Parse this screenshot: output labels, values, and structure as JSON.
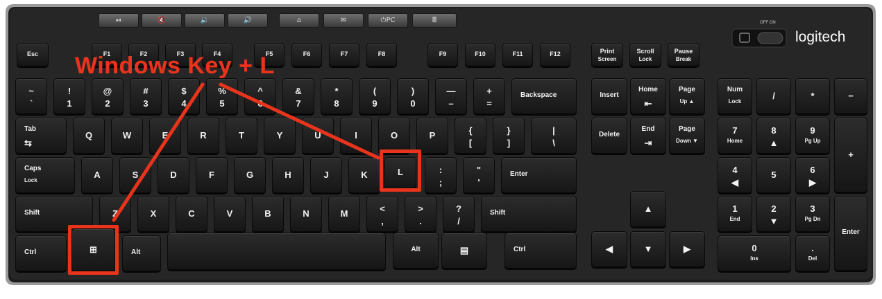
{
  "brand": "logitech",
  "power_switch_label": "OFF ON",
  "annotation": {
    "text": "Windows Key + L",
    "color": "#e8341c"
  },
  "media_keys": [
    "⏯",
    "🔇",
    "🔉",
    "🔊",
    "⌂",
    "✉",
    "⏻PC",
    "🖩"
  ],
  "keys": [
    {
      "id": "esc",
      "a": "Esc",
      "b": ""
    },
    {
      "id": "f1",
      "a": "F1",
      "b": ""
    },
    {
      "id": "f2",
      "a": "F2",
      "b": ""
    },
    {
      "id": "f3",
      "a": "F3",
      "b": ""
    },
    {
      "id": "f4",
      "a": "F4",
      "b": ""
    },
    {
      "id": "f5",
      "a": "F5",
      "b": ""
    },
    {
      "id": "f6",
      "a": "F6",
      "b": ""
    },
    {
      "id": "f7",
      "a": "F7",
      "b": ""
    },
    {
      "id": "f8",
      "a": "F8",
      "b": ""
    },
    {
      "id": "f9",
      "a": "F9",
      "b": ""
    },
    {
      "id": "f10",
      "a": "F10",
      "b": ""
    },
    {
      "id": "f11",
      "a": "F11",
      "b": ""
    },
    {
      "id": "f12",
      "a": "F12",
      "b": ""
    },
    {
      "id": "prtsc",
      "a": "Print",
      "b": "Screen"
    },
    {
      "id": "scrlk",
      "a": "Scroll",
      "b": "Lock"
    },
    {
      "id": "pause",
      "a": "Pause",
      "b": "Break"
    },
    {
      "id": "tilde",
      "a": "~",
      "b": "`"
    },
    {
      "id": "k1",
      "a": "!",
      "b": "1"
    },
    {
      "id": "k2",
      "a": "@",
      "b": "2"
    },
    {
      "id": "k3",
      "a": "#",
      "b": "3"
    },
    {
      "id": "k4",
      "a": "$",
      "b": "4"
    },
    {
      "id": "k5",
      "a": "%",
      "b": "5"
    },
    {
      "id": "k6",
      "a": "^",
      "b": "6"
    },
    {
      "id": "k7",
      "a": "&",
      "b": "7"
    },
    {
      "id": "k8",
      "a": "*",
      "b": "8"
    },
    {
      "id": "k9",
      "a": "(",
      "b": "9"
    },
    {
      "id": "k0",
      "a": ")",
      "b": "0"
    },
    {
      "id": "minus",
      "a": "—",
      "b": "–"
    },
    {
      "id": "equal",
      "a": "+",
      "b": "="
    },
    {
      "id": "backspace",
      "a": "Backspace",
      "b": ""
    },
    {
      "id": "insert",
      "a": "Insert",
      "b": ""
    },
    {
      "id": "home",
      "a": "Home",
      "b": "⇤"
    },
    {
      "id": "pgup",
      "a": "Page",
      "b": "Up ▲"
    },
    {
      "id": "numlk",
      "a": "Num",
      "b": "Lock"
    },
    {
      "id": "numdiv",
      "a": "/",
      "b": ""
    },
    {
      "id": "nummul",
      "a": "*",
      "b": ""
    },
    {
      "id": "numsub",
      "a": "−",
      "b": ""
    },
    {
      "id": "tab",
      "a": "Tab",
      "b": "⇆"
    },
    {
      "id": "q",
      "a": "Q",
      "b": ""
    },
    {
      "id": "w",
      "a": "W",
      "b": ""
    },
    {
      "id": "e",
      "a": "E",
      "b": ""
    },
    {
      "id": "r",
      "a": "R",
      "b": ""
    },
    {
      "id": "t",
      "a": "T",
      "b": ""
    },
    {
      "id": "y",
      "a": "Y",
      "b": ""
    },
    {
      "id": "u",
      "a": "U",
      "b": ""
    },
    {
      "id": "i",
      "a": "I",
      "b": ""
    },
    {
      "id": "o",
      "a": "O",
      "b": ""
    },
    {
      "id": "p",
      "a": "P",
      "b": ""
    },
    {
      "id": "lbracket",
      "a": "{",
      "b": "["
    },
    {
      "id": "rbracket",
      "a": "}",
      "b": "]"
    },
    {
      "id": "backslash",
      "a": "|",
      "b": "\\"
    },
    {
      "id": "delete",
      "a": "Delete",
      "b": ""
    },
    {
      "id": "end",
      "a": "End",
      "b": "⇥"
    },
    {
      "id": "pgdn",
      "a": "Page",
      "b": "Down ▼"
    },
    {
      "id": "num7",
      "a": "7",
      "b": "Home"
    },
    {
      "id": "num8",
      "a": "8",
      "b": "▲"
    },
    {
      "id": "num9",
      "a": "9",
      "b": "Pg Up"
    },
    {
      "id": "numadd",
      "a": "+",
      "b": ""
    },
    {
      "id": "caps",
      "a": "Caps",
      "b": "Lock"
    },
    {
      "id": "a",
      "a": "A",
      "b": ""
    },
    {
      "id": "s",
      "a": "S",
      "b": ""
    },
    {
      "id": "d",
      "a": "D",
      "b": ""
    },
    {
      "id": "f",
      "a": "F",
      "b": ""
    },
    {
      "id": "g",
      "a": "G",
      "b": ""
    },
    {
      "id": "h",
      "a": "H",
      "b": ""
    },
    {
      "id": "j",
      "a": "J",
      "b": ""
    },
    {
      "id": "k",
      "a": "K",
      "b": ""
    },
    {
      "id": "l",
      "a": "L",
      "b": ""
    },
    {
      "id": "semicolon",
      "a": ":",
      "b": ";"
    },
    {
      "id": "quote",
      "a": "\"",
      "b": "'"
    },
    {
      "id": "enter",
      "a": "Enter",
      "b": ""
    },
    {
      "id": "num4",
      "a": "4",
      "b": "◀"
    },
    {
      "id": "num5",
      "a": "5",
      "b": ""
    },
    {
      "id": "num6",
      "a": "6",
      "b": "▶"
    },
    {
      "id": "lshift",
      "a": "Shift",
      "b": ""
    },
    {
      "id": "z",
      "a": "Z",
      "b": ""
    },
    {
      "id": "x",
      "a": "X",
      "b": ""
    },
    {
      "id": "c",
      "a": "C",
      "b": ""
    },
    {
      "id": "v",
      "a": "V",
      "b": ""
    },
    {
      "id": "b",
      "a": "B",
      "b": ""
    },
    {
      "id": "n",
      "a": "N",
      "b": ""
    },
    {
      "id": "m",
      "a": "M",
      "b": ""
    },
    {
      "id": "comma",
      "a": "<",
      "b": ","
    },
    {
      "id": "period",
      "a": ">",
      "b": "."
    },
    {
      "id": "slash",
      "a": "?",
      "b": "/"
    },
    {
      "id": "rshift",
      "a": "Shift",
      "b": ""
    },
    {
      "id": "up",
      "a": "▲",
      "b": ""
    },
    {
      "id": "num1",
      "a": "1",
      "b": "End"
    },
    {
      "id": "num2",
      "a": "2",
      "b": "▼"
    },
    {
      "id": "num3",
      "a": "3",
      "b": "Pg Dn"
    },
    {
      "id": "numenter",
      "a": "Enter",
      "b": ""
    },
    {
      "id": "lctrl",
      "a": "Ctrl",
      "b": ""
    },
    {
      "id": "win",
      "a": "⊞",
      "b": ""
    },
    {
      "id": "lalt",
      "a": "Alt",
      "b": ""
    },
    {
      "id": "space",
      "a": "",
      "b": ""
    },
    {
      "id": "ralt",
      "a": "Alt",
      "b": ""
    },
    {
      "id": "menu",
      "a": "▤",
      "b": ""
    },
    {
      "id": "rctrl",
      "a": "Ctrl",
      "b": ""
    },
    {
      "id": "left",
      "a": "◀",
      "b": ""
    },
    {
      "id": "down",
      "a": "▼",
      "b": ""
    },
    {
      "id": "right",
      "a": "▶",
      "b": ""
    },
    {
      "id": "num0",
      "a": "0",
      "b": "Ins"
    },
    {
      "id": "numdot",
      "a": ".",
      "b": "Del"
    }
  ]
}
